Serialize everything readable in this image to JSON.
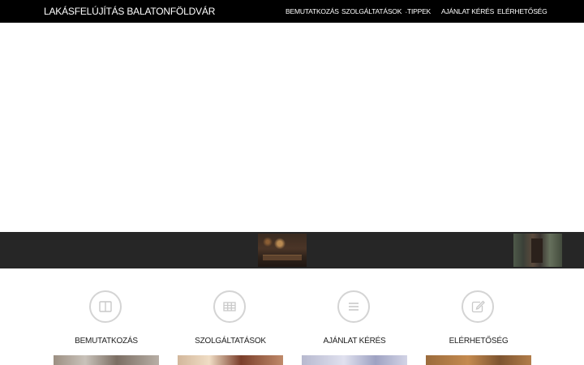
{
  "navbar": {
    "brand": "LAKÁSFELÚJÍTÁS BALATONFÖLDVÁR",
    "items": [
      {
        "label": "BEMUTATKOZÁS"
      },
      {
        "label": "SZOLGÁLTATÁSOK",
        "has_dropdown": true,
        "caret": "⌄"
      },
      {
        "label": "TIPPEK"
      },
      {
        "label": "AJÁNLAT KÉRÉS"
      },
      {
        "label": "ELÉRHETŐSÉG"
      }
    ]
  },
  "strip": {
    "thumbnails": [
      {
        "icon": "interior-photo"
      },
      {
        "icon": "interior-photo"
      }
    ]
  },
  "features": [
    {
      "title": "BEMUTATKOZÁS",
      "icon": "book-open-icon"
    },
    {
      "title": "SZOLGÁLTATÁSOK",
      "icon": "table-grid-icon"
    },
    {
      "title": "AJÁNLAT KÉRÉS",
      "icon": "list-lines-icon"
    },
    {
      "title": "ELÉRHETŐSÉG",
      "icon": "edit-icon"
    }
  ],
  "colors": {
    "navbar_bg": "#000000",
    "strip_bg": "#262626",
    "icon_circle": "#d4d4d4"
  }
}
